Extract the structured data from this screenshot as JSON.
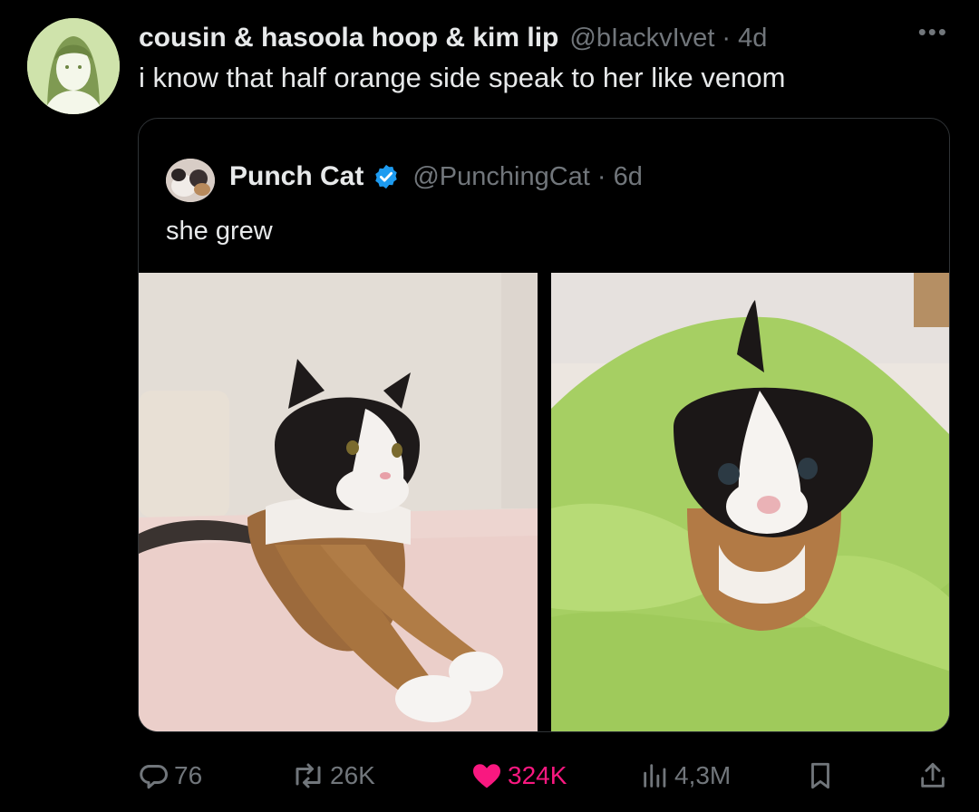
{
  "tweet": {
    "display_name": "cousin & hasoola hoop & kim lip",
    "handle_time": "@bIackvIvet · 4d",
    "text": "i know that half orange side speak to her like venom",
    "more_icon": "more-horizontal-icon"
  },
  "quoted": {
    "display_name": "Punch Cat",
    "handle_time": "@PunchingCat · 6d",
    "text": "she grew",
    "verified_color": "#1d9bf0"
  },
  "actions": {
    "replies": "76",
    "reposts": "26K",
    "likes": "324K",
    "views": "4,3M"
  },
  "colors": {
    "background": "#000000",
    "text": "#e7e9ea",
    "muted": "#71767b",
    "like": "#f91880",
    "border": "#2f3336"
  }
}
